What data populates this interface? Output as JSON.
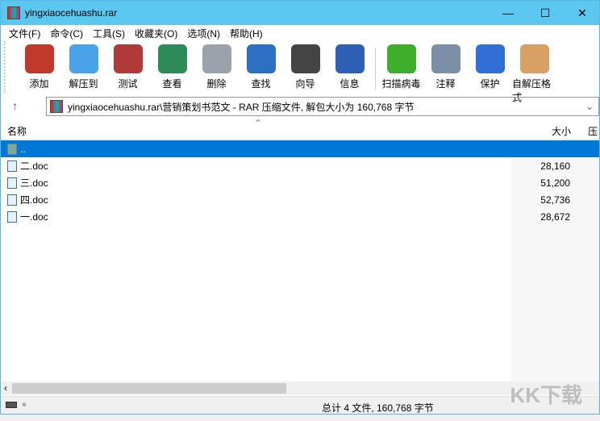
{
  "title": "yingxiaocehuashu.rar",
  "menu": [
    "文件(F)",
    "命令(C)",
    "工具(S)",
    "收藏夹(O)",
    "选项(N)",
    "帮助(H)"
  ],
  "toolbar": [
    {
      "label": "添加",
      "icon": "add-archive-icon",
      "color": "#c0392b"
    },
    {
      "label": "解压到",
      "icon": "extract-folder-icon",
      "color": "#4aa3e8"
    },
    {
      "label": "测试",
      "icon": "test-clipboard-icon",
      "color": "#b03a3a"
    },
    {
      "label": "查看",
      "icon": "view-book-icon",
      "color": "#2e8b57"
    },
    {
      "label": "删除",
      "icon": "trash-icon",
      "color": "#9aa3ab"
    },
    {
      "label": "查找",
      "icon": "search-magnifier-icon",
      "color": "#2d6fc2"
    },
    {
      "label": "向导",
      "icon": "wizard-wand-icon",
      "color": "#444"
    },
    {
      "label": "信息",
      "icon": "info-icon",
      "color": "#2d5fb5"
    },
    {
      "label": "扫描病毒",
      "icon": "virus-scan-icon",
      "color": "#3fae2a"
    },
    {
      "label": "注释",
      "icon": "comment-icon",
      "color": "#7d8fa6"
    },
    {
      "label": "保护",
      "icon": "shield-icon",
      "color": "#2f6fd6"
    },
    {
      "label": "自解压格式",
      "icon": "sfx-box-icon",
      "color": "#d9a066"
    }
  ],
  "address": "yingxiaocehuashu.rar\\营销策划书范文 - RAR 压缩文件, 解包大小为 160,768 字节",
  "columns": {
    "name": "名称",
    "size": "大小",
    "packed": "压缩"
  },
  "rows": [
    {
      "name": "..",
      "size": ""
    },
    {
      "name": "二.doc",
      "size": "28,160"
    },
    {
      "name": "三.doc",
      "size": "51,200"
    },
    {
      "name": "四.doc",
      "size": "52,736"
    },
    {
      "name": "一.doc",
      "size": "28,672"
    }
  ],
  "status": "总计 4 文件, 160,768 字节",
  "watermark": "KK下载 www.kkx.net"
}
